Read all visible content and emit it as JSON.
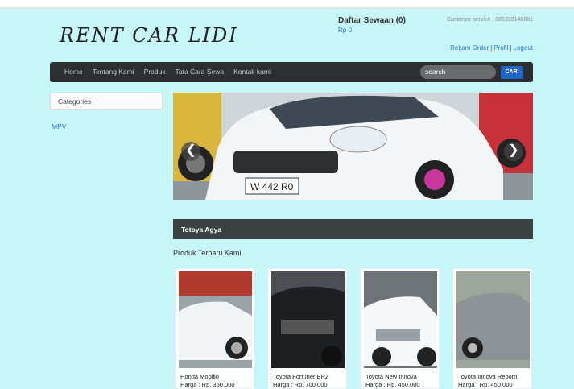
{
  "header": {
    "logo": "RENT CAR LIDI",
    "cart_title": "Daftar Sewaan (0)",
    "cart_amount": "Rp 0",
    "customer_service": "Customer service : 081939146681",
    "account_links": [
      "Rekam Order",
      "Profil",
      "Logout"
    ]
  },
  "nav": {
    "items": [
      "Home",
      "Tentang Kami",
      "Produk",
      "Tata Cara Sewa",
      "Kontak kami"
    ],
    "search_placeholder": "search",
    "search_button": "CARI"
  },
  "sidebar": {
    "title": "Categories",
    "items": [
      "MPV"
    ]
  },
  "slider": {
    "plate": "W 442 R0",
    "prev": "❮",
    "next": "❯"
  },
  "main": {
    "section_title": "Totoya Agya",
    "latest_title": "Produk Terbaru Kami",
    "products": [
      {
        "name": "Honda Mobilio",
        "price": "Harga : Rp. 350.000"
      },
      {
        "name": "Toyota Fortuner BRZ",
        "price": "Harga : Rp. 700.000"
      },
      {
        "name": "Toyota New Innova",
        "price": "Harga : Rp. 450.000"
      },
      {
        "name": "Toyota Innova Reborn",
        "price": "Harga : Rp. 450.000"
      }
    ]
  },
  "colors": {
    "background": "#c7f6f8",
    "navbar": "#2e2f31",
    "link": "#2a7bd6",
    "section_bar": "#3b4141",
    "button": "#1f66c9"
  }
}
